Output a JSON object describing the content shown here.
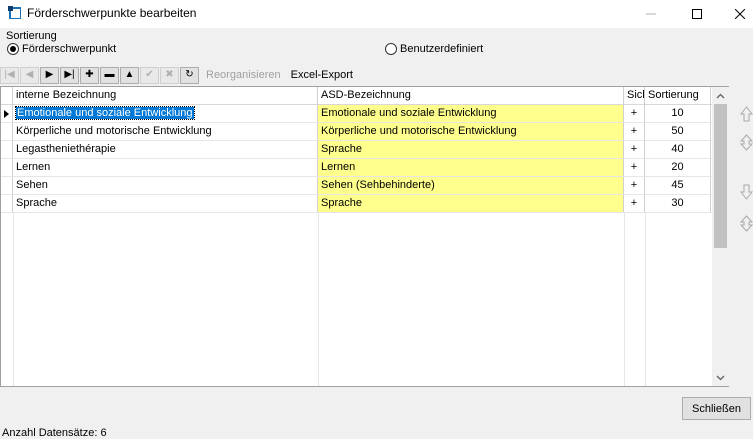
{
  "window": {
    "title": "Förderschwerpunkte bearbeiten",
    "minimize_glyph": "—",
    "maximize_glyph": "☐",
    "close_glyph": "✕"
  },
  "sorting": {
    "label": "Sortierung",
    "options": [
      {
        "label": "Förderschwerpunkt",
        "checked": true
      },
      {
        "label": "Benutzerdefiniert",
        "checked": false
      }
    ]
  },
  "toolbar": {
    "buttons": [
      {
        "name": "first-record",
        "glyph": "|◀",
        "enabled": false
      },
      {
        "name": "prior-record",
        "glyph": "◀",
        "enabled": false
      },
      {
        "name": "next-record",
        "glyph": "▶",
        "enabled": true
      },
      {
        "name": "last-record",
        "glyph": "▶|",
        "enabled": true
      },
      {
        "name": "insert-record",
        "glyph": "✚",
        "enabled": true
      },
      {
        "name": "delete-record",
        "glyph": "▬",
        "enabled": true
      },
      {
        "name": "edit-record",
        "glyph": "▲",
        "enabled": true
      },
      {
        "name": "post-record",
        "glyph": "✔",
        "enabled": false
      },
      {
        "name": "cancel-record",
        "glyph": "✖",
        "enabled": false
      },
      {
        "name": "refresh-records",
        "glyph": "↻",
        "enabled": true
      }
    ],
    "reorganize_label": "Reorganisieren",
    "excel_export_label": "Excel-Export"
  },
  "grid": {
    "columns": [
      "interne Bezeichnung",
      "ASD-Bezeichnung",
      "Sicht",
      "Sortierung"
    ],
    "rows": [
      {
        "intern": "Emotionale und soziale Entwicklung",
        "asd": "Emotionale und soziale Entwicklung",
        "sicht": "+",
        "sort": "10",
        "selected": true
      },
      {
        "intern": "Körperliche und motorische Entwicklung",
        "asd": "Körperliche und motorische Entwicklung",
        "sicht": "+",
        "sort": "50"
      },
      {
        "intern": "Legastheniethérapie",
        "asd": "Sprache",
        "sicht": "+",
        "sort": "40"
      },
      {
        "intern": "Lernen",
        "asd": "Lernen",
        "sicht": "+",
        "sort": "20"
      },
      {
        "intern": "Sehen",
        "asd": "Sehen (Sehbehinderte)",
        "sicht": "+",
        "sort": "45"
      },
      {
        "intern": "Sprache",
        "asd": "Sprache",
        "sicht": "+",
        "sort": "30"
      }
    ]
  },
  "side_buttons": [
    "move-top",
    "move-up",
    "move-down",
    "move-bottom"
  ],
  "close_button_label": "Schließen",
  "status_text": "Anzahl Datensätze: 6"
}
